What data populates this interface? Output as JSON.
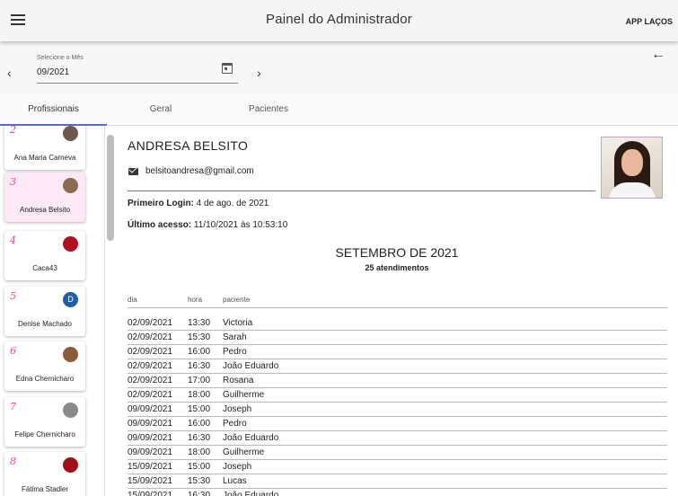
{
  "appbar": {
    "title": "Painel do Administrador",
    "link_label": "APP LAÇOS"
  },
  "month_picker": {
    "label": "Selecione o Mês",
    "value": "09/2021",
    "prev": "‹",
    "next": "›",
    "back": "←"
  },
  "tabs": [
    {
      "label": "Profissionais",
      "active": true
    },
    {
      "label": "Geral",
      "active": false
    },
    {
      "label": "Pacientes",
      "active": false
    }
  ],
  "professionals": [
    {
      "num": "2",
      "name": "Ana Maria Carneva",
      "avatar_color": "#6b5a4a",
      "initial": ""
    },
    {
      "num": "3",
      "name": "Andresa Belsito",
      "avatar_color": "#8a6a50",
      "initial": "",
      "selected": true
    },
    {
      "num": "4",
      "name": "Caca43",
      "avatar_color": "#b01020",
      "initial": ""
    },
    {
      "num": "5",
      "name": "Denise Machado",
      "avatar_color": "#1f5fa8",
      "initial": "D"
    },
    {
      "num": "6",
      "name": "Edna Chernicharo",
      "avatar_color": "#8a5a3a",
      "initial": ""
    },
    {
      "num": "7",
      "name": "Felipe Chernicharo",
      "avatar_color": "#8a8a8a",
      "initial": ""
    },
    {
      "num": "8",
      "name": "Fátima Stadler",
      "avatar_color": "#a01018",
      "initial": ""
    }
  ],
  "detail": {
    "name": "ANDRESA BELSITO",
    "email": "belsitoandresa@gmail.com",
    "first_login_label": "Primeiro Login:",
    "first_login_value": " 4 de ago. de 2021",
    "last_access_label": "Último acesso:",
    "last_access_value": " 11/10/2021 às 10:53:10",
    "month_title": "SETEMBRO DE 2021",
    "month_sub": "25 atendimentos",
    "columns": [
      "dia",
      "hora",
      "paciente"
    ],
    "rows": [
      [
        "02/09/2021",
        "13:30",
        "Victoria"
      ],
      [
        "02/09/2021",
        "15:30",
        "Sarah"
      ],
      [
        "02/09/2021",
        "16:00",
        "Pedro"
      ],
      [
        "02/09/2021",
        "16:30",
        "João Eduardo"
      ],
      [
        "02/09/2021",
        "17:00",
        "Rosana"
      ],
      [
        "02/09/2021",
        "18:00",
        "Guilherme"
      ],
      [
        "09/09/2021",
        "15:00",
        "Joseph"
      ],
      [
        "09/09/2021",
        "16:00",
        "Pedro"
      ],
      [
        "09/09/2021",
        "16:30",
        "João Eduardo"
      ],
      [
        "09/09/2021",
        "18:00",
        "Guilherme"
      ],
      [
        "15/09/2021",
        "15:00",
        "Joseph"
      ],
      [
        "15/09/2021",
        "15:30",
        "Lucas"
      ],
      [
        "15/09/2021",
        "16:30",
        "João Eduardo"
      ]
    ]
  }
}
